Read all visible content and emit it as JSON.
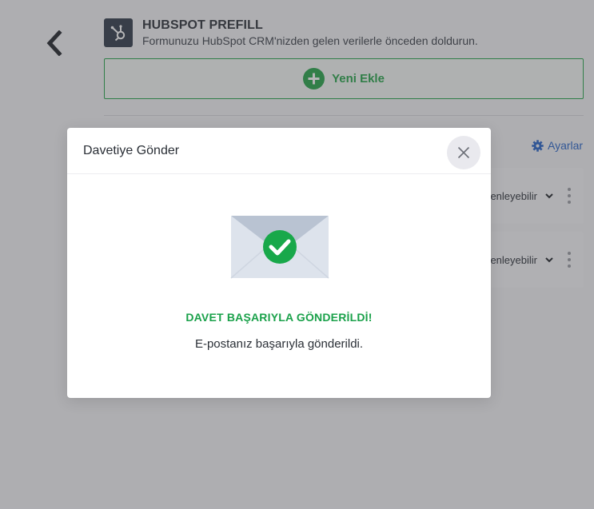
{
  "header": {
    "title": "HUBSPOT PREFILL",
    "subtitle": "Formunuzu HubSpot CRM'nizden gelen verilerle önceden doldurun."
  },
  "add_new": {
    "label": "Yeni Ekle"
  },
  "settings": {
    "label": "Ayarlar"
  },
  "rows": [
    {
      "permission": "enleyebilir"
    },
    {
      "permission": "enleyebilir"
    }
  ],
  "modal": {
    "title": "Davetiye Gönder",
    "success_title": "DAVET BAŞARIYLA GÖNDERİLDİ!",
    "success_message": "E-postanız başarıyla gönderildi."
  },
  "colors": {
    "accent_green": "#23a446",
    "link_blue": "#2563c8",
    "hubspot_dark": "#2f3a48"
  },
  "icons": {
    "back": "chevron-left-icon",
    "logo": "hubspot-logo-icon",
    "add": "plus-circle-icon",
    "settings": "gear-icon",
    "close": "close-icon",
    "envelope": "envelope-check-icon"
  }
}
